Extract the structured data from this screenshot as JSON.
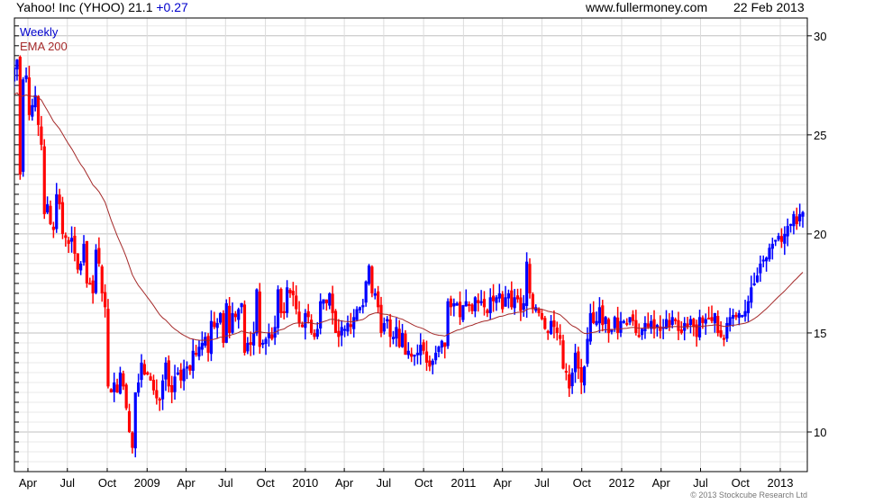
{
  "header": {
    "title": "Yahoo! Inc (YHOO) 21.1",
    "change": "+0.27",
    "website": "www.fullermoney.com",
    "date": "22 Feb 2013"
  },
  "footer": {
    "copyright": "© 2013 Stockcube Research Ltd"
  },
  "colors": {
    "up": "#0000ff",
    "down": "#ff0000",
    "ema": "#a52a2a",
    "grid_major": "#c0c0c0",
    "grid_minor": "#e8e8e8"
  },
  "chart_data": {
    "type": "candlestick",
    "legend": [
      "Weekly",
      "EMA 200"
    ],
    "legend_placement": "top-left",
    "ylim": [
      8,
      30.9
    ],
    "y_ticks": [
      10,
      15,
      20,
      25,
      30
    ],
    "x_ticks": [
      {
        "label": "Apr",
        "date": "2008-04-01"
      },
      {
        "label": "Jul",
        "date": "2008-07-01"
      },
      {
        "label": "Oct",
        "date": "2008-10-01"
      },
      {
        "label": "2009",
        "date": "2009-01-01"
      },
      {
        "label": "Apr",
        "date": "2009-04-01"
      },
      {
        "label": "Jul",
        "date": "2009-07-01"
      },
      {
        "label": "Oct",
        "date": "2009-10-01"
      },
      {
        "label": "2010",
        "date": "2010-01-01"
      },
      {
        "label": "Apr",
        "date": "2010-04-01"
      },
      {
        "label": "Jul",
        "date": "2010-07-01"
      },
      {
        "label": "Oct",
        "date": "2010-10-01"
      },
      {
        "label": "2011",
        "date": "2011-01-01"
      },
      {
        "label": "Apr",
        "date": "2011-04-01"
      },
      {
        "label": "Jul",
        "date": "2011-07-01"
      },
      {
        "label": "Oct",
        "date": "2011-10-01"
      },
      {
        "label": "2012",
        "date": "2012-01-01"
      },
      {
        "label": "Apr",
        "date": "2012-04-01"
      },
      {
        "label": "Jul",
        "date": "2012-07-01"
      },
      {
        "label": "Oct",
        "date": "2012-10-01"
      },
      {
        "label": "2013",
        "date": "2013-01-01"
      }
    ],
    "last_date": "2013-02-22",
    "ema_period_days": 200,
    "weekly_close": [
      26.8,
      28.5,
      27.5,
      29.0,
      28.5,
      27.8,
      28.4,
      28.8,
      23.0,
      27.8,
      28.0,
      26.0,
      26.5,
      27.0,
      25.5,
      24.5,
      21.0,
      21.5,
      20.5,
      20.2,
      22.0,
      21.5,
      20.0,
      19.8,
      19.5,
      19.8,
      19.0,
      18.2,
      18.5,
      19.5,
      17.5,
      17.5,
      17.0,
      19.2,
      18.5,
      17.0,
      16.3,
      12.3,
      12.0,
      12.5,
      12.0,
      13.0,
      12.3,
      11.2,
      10.0,
      9.2,
      12.0,
      12.5,
      13.5,
      12.9,
      12.9,
      12.6,
      12.1,
      11.7,
      11.6,
      12.6,
      13.5,
      12.3,
      12.0,
      12.8,
      13.0,
      12.6,
      13.2,
      13.3,
      13.1,
      14.1,
      13.9,
      14.3,
      14.5,
      14.8,
      14.0,
      15.6,
      15.3,
      15.5,
      16.0,
      14.5,
      16.5,
      15.0,
      16.0,
      15.8,
      16.2,
      16.5,
      14.0,
      14.5,
      14.4,
      15.0,
      17.2,
      14.3,
      14.5,
      14.7,
      15.0,
      14.7,
      15.3,
      17.2,
      16.0,
      16.0,
      17.3,
      17.0,
      16.9,
      16.2,
      15.5,
      15.3,
      16.0,
      15.8,
      15.0,
      14.8,
      15.2,
      16.6,
      16.7,
      16.5,
      17.0,
      16.0,
      15.0,
      14.8,
      15.3,
      15.2,
      15.5,
      15.3,
      15.8,
      16.2,
      16.3,
      16.4,
      17.6,
      18.4,
      17.0,
      17.0,
      16.3,
      15.0,
      15.5,
      15.7,
      14.8,
      14.8,
      15.3,
      14.3,
      15.0,
      13.9,
      14.1,
      13.8,
      13.9,
      14.0,
      14.4,
      14.1,
      13.5,
      13.3,
      13.6,
      14.0,
      14.3,
      14.6,
      14.3,
      16.6,
      16.3,
      16.5,
      16.5,
      15.8,
      16.4,
      16.6,
      16.4,
      16.1,
      16.8,
      16.5,
      16.6,
      16.3,
      16.0,
      16.8,
      16.6,
      16.8,
      17.0,
      16.2,
      16.8,
      17.0,
      16.3,
      16.8,
      16.7,
      16.1,
      16.5,
      18.6,
      17.0,
      16.2,
      16.3,
      16.0,
      15.7,
      15.2,
      15.0,
      15.6,
      15.3,
      15.0,
      14.7,
      13.2,
      13.0,
      12.2,
      13.0,
      14.0,
      13.2,
      12.5,
      13.3,
      14.7,
      16.0,
      15.5,
      15.6,
      16.3,
      15.4,
      15.8,
      15.0,
      15.2,
      15.8,
      15.0,
      15.6,
      15.6,
      15.5,
      15.8,
      15.6,
      15.0,
      14.8,
      15.2,
      15.5,
      15.3,
      15.6,
      15.2,
      15.4,
      15.1,
      15.3,
      15.7,
      15.3,
      15.8,
      15.6,
      15.1,
      15.0,
      15.5,
      15.3,
      15.7,
      15.3,
      14.8,
      15.8,
      15.5,
      15.7,
      15.7,
      15.6,
      16.0,
      15.0,
      14.8,
      14.7,
      15.5,
      15.8,
      15.9,
      15.8,
      16.0,
      15.9,
      16.1,
      16.6,
      17.3,
      17.5,
      17.9,
      18.5,
      18.7,
      18.8,
      19.3,
      19.5,
      19.7,
      19.9,
      19.6,
      20.0,
      20.4,
      20.5,
      21.0,
      20.5,
      21.0,
      21.1
    ]
  }
}
